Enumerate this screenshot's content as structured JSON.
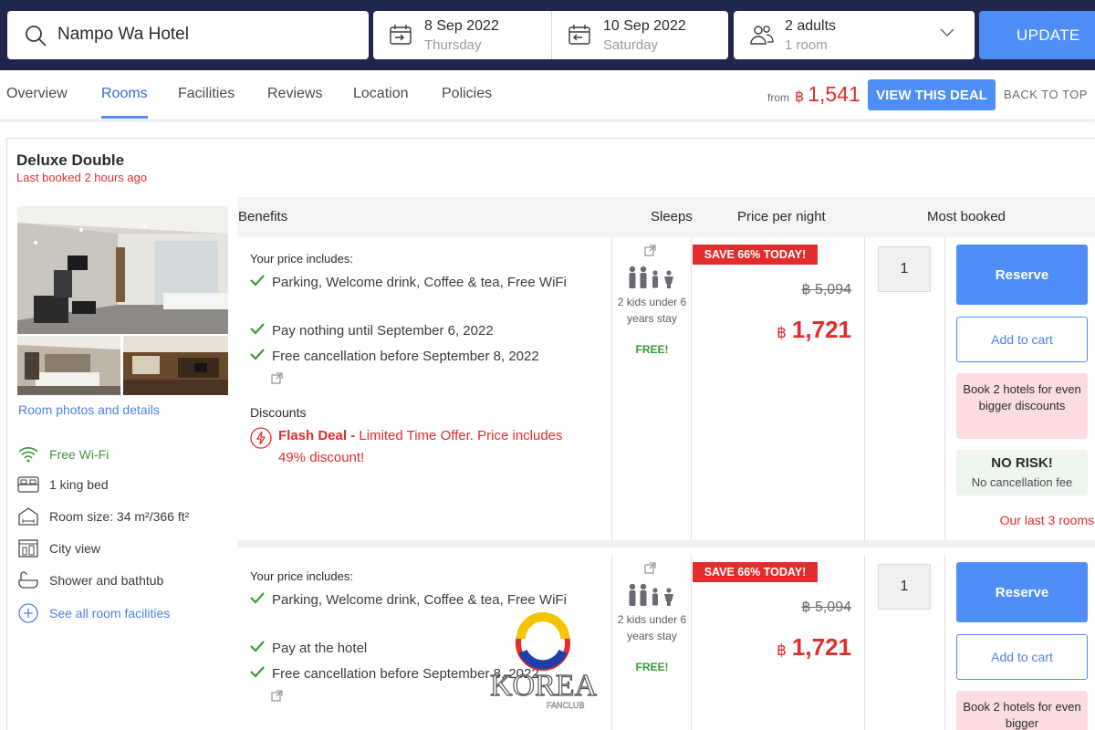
{
  "search": {
    "hotel": "Nampo Wa Hotel",
    "checkin_date": "8 Sep 2022",
    "checkin_day": "Thursday",
    "checkout_date": "10 Sep 2022",
    "checkout_day": "Saturday",
    "guests": "2 adults",
    "rooms": "1 room",
    "update_label": "UPDATE"
  },
  "nav": {
    "tabs": [
      "Overview",
      "Rooms",
      "Facilities",
      "Reviews",
      "Location",
      "Policies"
    ],
    "active_tab": "Rooms",
    "from_label": "from",
    "currency": "฿",
    "from_price": "1,541",
    "deal_label": "VIEW THIS DEAL",
    "back_to_top": "BACK TO TOP"
  },
  "room": {
    "title": "Deluxe Double",
    "last_booked": "Last booked 2 hours ago",
    "photos_link": "Room photos and details",
    "facilities": [
      {
        "icon": "wifi-icon",
        "label": "Free Wi-Fi"
      },
      {
        "icon": "bed-icon",
        "label": "1 king bed"
      },
      {
        "icon": "room-size-icon",
        "label": "Room size: 34 m²/366 ft²"
      },
      {
        "icon": "city-view-icon",
        "label": "City view"
      },
      {
        "icon": "bathtub-icon",
        "label": "Shower and bathtub"
      },
      {
        "icon": "plus-circle-icon",
        "label": "See all room facilities"
      }
    ]
  },
  "table": {
    "headers": {
      "benefits": "Benefits",
      "sleeps": "Sleeps",
      "price": "Price per night",
      "most_booked": "Most booked"
    }
  },
  "offers": [
    {
      "includes_title": "Your price includes:",
      "benefits": [
        "Parking, Welcome drink, Coffee & tea, Free WiFi",
        "Pay nothing until September 6, 2022",
        "Free cancellation before September 8, 2022"
      ],
      "discounts_title": "Discounts",
      "flash_label": "Flash Deal -",
      "flash_text": " Limited Time Offer. Price includes 49% discount!",
      "sleeps_text": "2 kids under 6 years stay",
      "sleeps_free": "FREE!",
      "save_badge": "SAVE 66% TODAY!",
      "old_price": "฿ 5,094",
      "currency": "฿",
      "new_price": "1,721",
      "qty": "1",
      "reserve_label": "Reserve",
      "cart_label": "Add to cart",
      "promo": "Book 2 hotels for even bigger discounts",
      "norisk_title": "NO RISK!",
      "norisk_sub": "No cancellation fee",
      "last_rooms": "Our last 3 rooms!"
    },
    {
      "includes_title": "Your price includes:",
      "benefits": [
        "Parking, Welcome drink, Coffee & tea, Free WiFi",
        "Pay at the hotel",
        "Free cancellation before September 8, 2022"
      ],
      "sleeps_text": "2 kids under 6 years stay",
      "sleeps_free": "FREE!",
      "save_badge": "SAVE 66% TODAY!",
      "old_price": "฿ 5,094",
      "currency": "฿",
      "new_price": "1,721",
      "qty": "1",
      "reserve_label": "Reserve",
      "cart_label": "Add to cart",
      "promo": "Book 2 hotels for even bigger"
    }
  ],
  "watermark": {
    "text": "KOREA",
    "sub": "FANCLUB"
  },
  "colors": {
    "navy": "#20274d",
    "accent": "#4f8ef7",
    "red": "#e12d2d",
    "green": "#3b9a3b"
  }
}
